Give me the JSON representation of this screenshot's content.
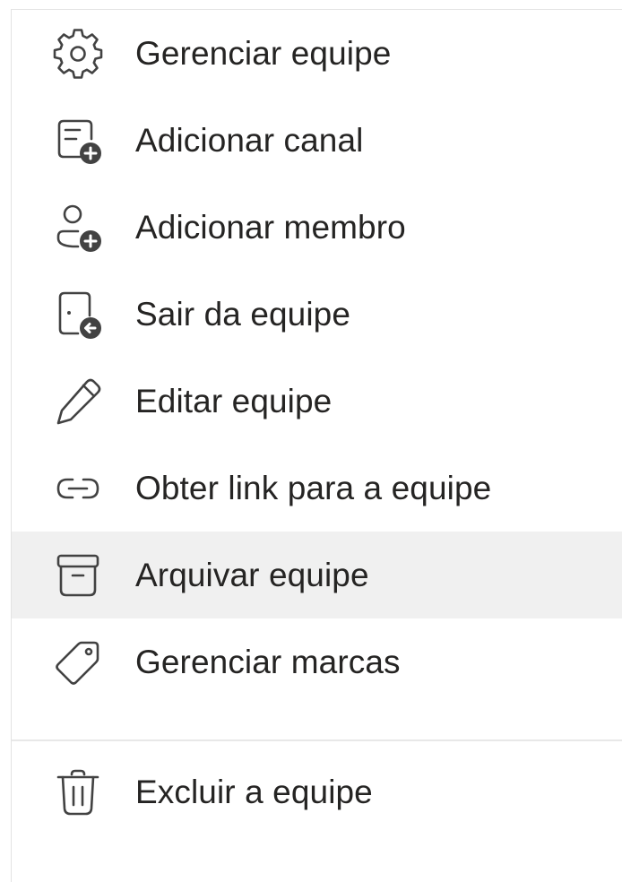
{
  "menu": {
    "items": [
      {
        "label": "Gerenciar equipe",
        "icon": "gear-icon"
      },
      {
        "label": "Adicionar canal",
        "icon": "add-channel-icon"
      },
      {
        "label": "Adicionar membro",
        "icon": "add-member-icon"
      },
      {
        "label": "Sair da equipe",
        "icon": "leave-team-icon"
      },
      {
        "label": "Editar equipe",
        "icon": "pencil-icon"
      },
      {
        "label": "Obter link para a equipe",
        "icon": "link-icon"
      },
      {
        "label": "Arquivar equipe",
        "icon": "archive-icon",
        "highlighted": true
      },
      {
        "label": "Gerenciar marcas",
        "icon": "tag-icon"
      }
    ],
    "danger_items": [
      {
        "label": "Excluir a equipe",
        "icon": "trash-icon"
      }
    ]
  },
  "colors": {
    "text": "#252423",
    "icon": "#424242",
    "highlight": "#f0f0f0",
    "divider": "#e8e8e8"
  }
}
